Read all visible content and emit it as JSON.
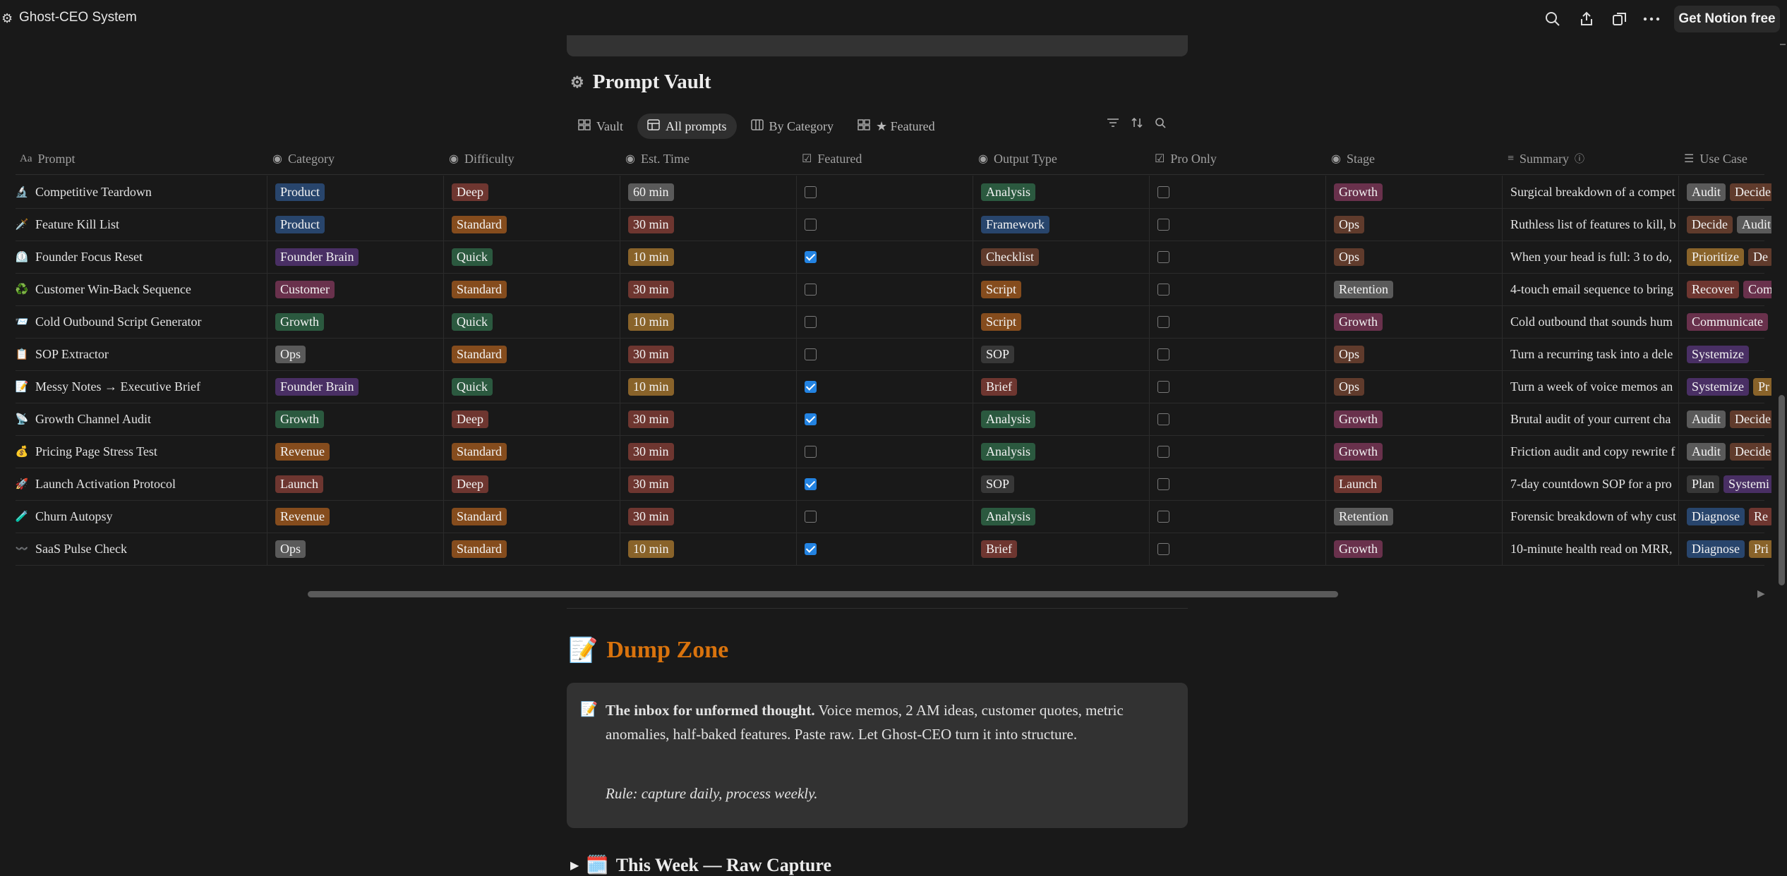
{
  "app": {
    "title": "Ghost-CEO System",
    "cta": "Get Notion free"
  },
  "section": {
    "title": "Prompt Vault"
  },
  "views": [
    {
      "label": "Vault",
      "active": false
    },
    {
      "label": "All prompts",
      "active": true
    },
    {
      "label": "By Category",
      "active": false
    },
    {
      "label": "★ Featured",
      "active": false
    }
  ],
  "columns": [
    "Prompt",
    "Category",
    "Difficulty",
    "Est. Time",
    "Featured",
    "Output Type",
    "Pro Only",
    "Stage",
    "Summary",
    "Use Case"
  ],
  "colors": {
    "blue": "#28456c",
    "red": "#6e3630",
    "green": "#2b593f",
    "orange": "#854c1d",
    "purple": "#492f64",
    "pink": "#69314c",
    "yellow": "#89632a",
    "gray": "#5a5a5a",
    "brown": "#603b2c",
    "default": "#373737"
  },
  "rows": [
    {
      "icon": "🔬",
      "prompt": "Competitive Teardown",
      "category": {
        "t": "Product",
        "c": "blue"
      },
      "difficulty": {
        "t": "Deep",
        "c": "red"
      },
      "time": {
        "t": "60 min",
        "c": "gray"
      },
      "featured": false,
      "output": {
        "t": "Analysis",
        "c": "green"
      },
      "pro": false,
      "stage": {
        "t": "Growth",
        "c": "pink"
      },
      "summary": "Surgical breakdown of a compet",
      "use": [
        {
          "t": "Audit",
          "c": "gray"
        },
        {
          "t": "Decide",
          "c": "brown"
        }
      ]
    },
    {
      "icon": "🗡️",
      "prompt": "Feature Kill List",
      "category": {
        "t": "Product",
        "c": "blue"
      },
      "difficulty": {
        "t": "Standard",
        "c": "orange"
      },
      "time": {
        "t": "30 min",
        "c": "red"
      },
      "featured": false,
      "output": {
        "t": "Framework",
        "c": "blue"
      },
      "pro": false,
      "stage": {
        "t": "Ops",
        "c": "brown"
      },
      "summary": "Ruthless list of features to kill, b",
      "use": [
        {
          "t": "Decide",
          "c": "brown"
        },
        {
          "t": "Audit",
          "c": "gray"
        }
      ]
    },
    {
      "icon": "⏲️",
      "prompt": "Founder Focus Reset",
      "category": {
        "t": "Founder Brain",
        "c": "purple"
      },
      "difficulty": {
        "t": "Quick",
        "c": "green"
      },
      "time": {
        "t": "10 min",
        "c": "yellow"
      },
      "featured": true,
      "output": {
        "t": "Checklist",
        "c": "brown"
      },
      "pro": false,
      "stage": {
        "t": "Ops",
        "c": "brown"
      },
      "summary": "When your head is full: 3 to do,",
      "use": [
        {
          "t": "Prioritize",
          "c": "yellow"
        },
        {
          "t": "De",
          "c": "brown"
        }
      ]
    },
    {
      "icon": "♻️",
      "prompt": "Customer Win-Back Sequence",
      "category": {
        "t": "Customer",
        "c": "pink"
      },
      "difficulty": {
        "t": "Standard",
        "c": "orange"
      },
      "time": {
        "t": "30 min",
        "c": "red"
      },
      "featured": false,
      "output": {
        "t": "Script",
        "c": "orange"
      },
      "pro": false,
      "stage": {
        "t": "Retention",
        "c": "gray"
      },
      "summary": "4-touch email sequence to bring",
      "use": [
        {
          "t": "Recover",
          "c": "red"
        },
        {
          "t": "Com",
          "c": "pink"
        }
      ]
    },
    {
      "icon": "📨",
      "prompt": "Cold Outbound Script Generator",
      "category": {
        "t": "Growth",
        "c": "green"
      },
      "difficulty": {
        "t": "Quick",
        "c": "green"
      },
      "time": {
        "t": "10 min",
        "c": "yellow"
      },
      "featured": false,
      "output": {
        "t": "Script",
        "c": "orange"
      },
      "pro": false,
      "stage": {
        "t": "Growth",
        "c": "pink"
      },
      "summary": "Cold outbound that sounds hum",
      "use": [
        {
          "t": "Communicate",
          "c": "pink"
        }
      ]
    },
    {
      "icon": "📋",
      "prompt": "SOP Extractor",
      "category": {
        "t": "Ops",
        "c": "gray"
      },
      "difficulty": {
        "t": "Standard",
        "c": "orange"
      },
      "time": {
        "t": "30 min",
        "c": "red"
      },
      "featured": false,
      "output": {
        "t": "SOP",
        "c": "default"
      },
      "pro": false,
      "stage": {
        "t": "Ops",
        "c": "brown"
      },
      "summary": "Turn a recurring task into a dele",
      "use": [
        {
          "t": "Systemize",
          "c": "purple"
        }
      ]
    },
    {
      "icon": "📝",
      "prompt": "Messy Notes → Executive Brief",
      "category": {
        "t": "Founder Brain",
        "c": "purple"
      },
      "difficulty": {
        "t": "Quick",
        "c": "green"
      },
      "time": {
        "t": "10 min",
        "c": "yellow"
      },
      "featured": true,
      "output": {
        "t": "Brief",
        "c": "red"
      },
      "pro": false,
      "stage": {
        "t": "Ops",
        "c": "brown"
      },
      "summary": "Turn a week of voice memos an",
      "use": [
        {
          "t": "Systemize",
          "c": "purple"
        },
        {
          "t": "Pr",
          "c": "yellow"
        }
      ]
    },
    {
      "icon": "📡",
      "prompt": "Growth Channel Audit",
      "category": {
        "t": "Growth",
        "c": "green"
      },
      "difficulty": {
        "t": "Deep",
        "c": "red"
      },
      "time": {
        "t": "30 min",
        "c": "red"
      },
      "featured": true,
      "output": {
        "t": "Analysis",
        "c": "green"
      },
      "pro": false,
      "stage": {
        "t": "Growth",
        "c": "pink"
      },
      "summary": "Brutal audit of your current cha",
      "use": [
        {
          "t": "Audit",
          "c": "gray"
        },
        {
          "t": "Decide",
          "c": "brown"
        }
      ]
    },
    {
      "icon": "💰",
      "prompt": "Pricing Page Stress Test",
      "category": {
        "t": "Revenue",
        "c": "orange"
      },
      "difficulty": {
        "t": "Standard",
        "c": "orange"
      },
      "time": {
        "t": "30 min",
        "c": "red"
      },
      "featured": false,
      "output": {
        "t": "Analysis",
        "c": "green"
      },
      "pro": false,
      "stage": {
        "t": "Growth",
        "c": "pink"
      },
      "summary": "Friction audit and copy rewrite f",
      "use": [
        {
          "t": "Audit",
          "c": "gray"
        },
        {
          "t": "Decide",
          "c": "brown"
        }
      ]
    },
    {
      "icon": "🚀",
      "prompt": "Launch Activation Protocol",
      "category": {
        "t": "Launch",
        "c": "red"
      },
      "difficulty": {
        "t": "Deep",
        "c": "red"
      },
      "time": {
        "t": "30 min",
        "c": "red"
      },
      "featured": true,
      "output": {
        "t": "SOP",
        "c": "default"
      },
      "pro": false,
      "stage": {
        "t": "Launch",
        "c": "red"
      },
      "summary": "7-day countdown SOP for a pro",
      "use": [
        {
          "t": "Plan",
          "c": "default"
        },
        {
          "t": "Systemi",
          "c": "purple"
        }
      ]
    },
    {
      "icon": "🧪",
      "prompt": "Churn Autopsy",
      "category": {
        "t": "Revenue",
        "c": "orange"
      },
      "difficulty": {
        "t": "Standard",
        "c": "orange"
      },
      "time": {
        "t": "30 min",
        "c": "red"
      },
      "featured": false,
      "output": {
        "t": "Analysis",
        "c": "green"
      },
      "pro": false,
      "stage": {
        "t": "Retention",
        "c": "gray"
      },
      "summary": "Forensic breakdown of why cust",
      "use": [
        {
          "t": "Diagnose",
          "c": "blue"
        },
        {
          "t": "Re",
          "c": "red"
        }
      ]
    },
    {
      "icon": "〰️",
      "prompt": "SaaS Pulse Check",
      "category": {
        "t": "Ops",
        "c": "gray"
      },
      "difficulty": {
        "t": "Standard",
        "c": "orange"
      },
      "time": {
        "t": "10 min",
        "c": "yellow"
      },
      "featured": true,
      "output": {
        "t": "Brief",
        "c": "red"
      },
      "pro": false,
      "stage": {
        "t": "Growth",
        "c": "pink"
      },
      "summary": "10-minute health read on MRR,",
      "use": [
        {
          "t": "Diagnose",
          "c": "blue"
        },
        {
          "t": "Pri",
          "c": "yellow"
        }
      ]
    }
  ],
  "dump": {
    "title": "Dump Zone",
    "callout_bold": "The inbox for unformed thought.",
    "callout_text": " Voice memos, 2 AM ideas, customer quotes, metric anomalies, half-baked features. Paste raw. Let Ghost-CEO turn it into structure.",
    "rule": "Rule: capture daily, process weekly.",
    "toggle": "This Week — Raw Capture"
  }
}
